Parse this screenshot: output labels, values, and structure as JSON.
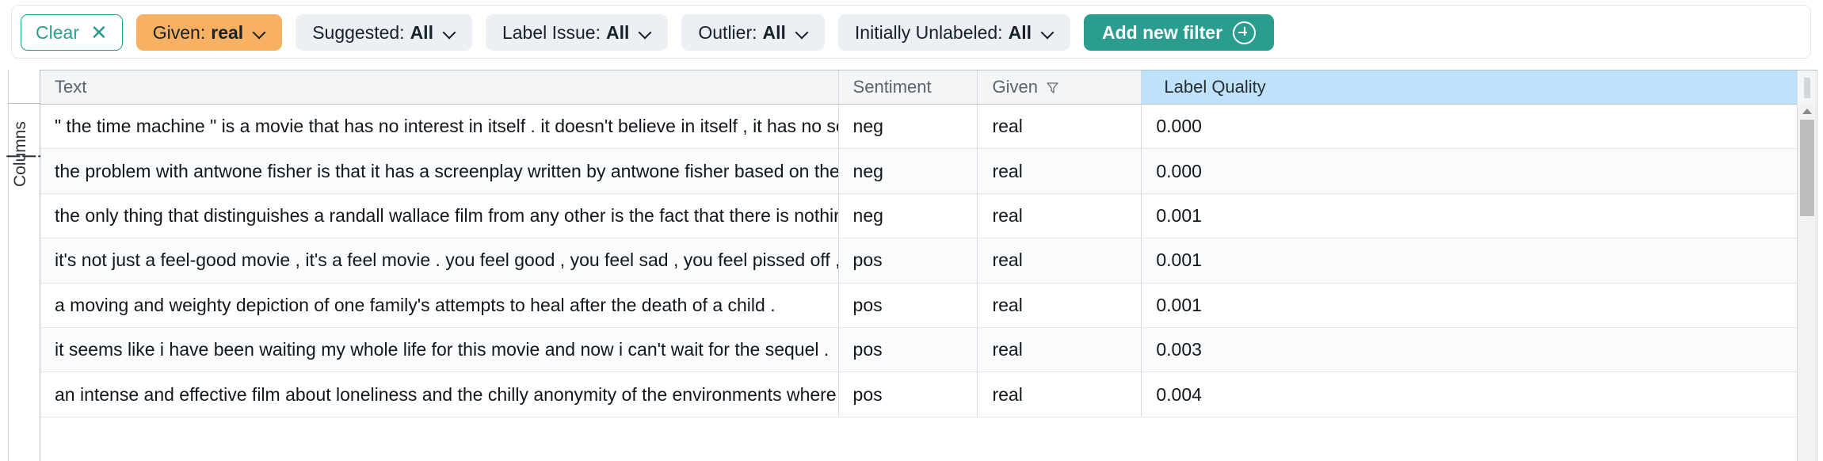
{
  "filter_bar": {
    "clear": {
      "label": "Clear",
      "icon": "close-icon",
      "glyph": "✕"
    },
    "filters": [
      {
        "label": "Given:",
        "value": "real",
        "active": true
      },
      {
        "label": "Suggested:",
        "value": "All",
        "active": false
      },
      {
        "label": "Label Issue:",
        "value": "All",
        "active": false
      },
      {
        "label": "Outlier:",
        "value": "All",
        "active": false
      },
      {
        "label": "Initially Unlabeled:",
        "value": "All",
        "active": false
      }
    ],
    "add_filter": {
      "label": "Add new filter",
      "icon": "plus-circle-icon"
    }
  },
  "columns_rail": {
    "label": "Columns",
    "icon": "columns-hamburger-icon"
  },
  "table": {
    "headers": [
      {
        "label": "Text",
        "selected": false,
        "filter_icon": false
      },
      {
        "label": "Sentiment",
        "selected": false,
        "filter_icon": false
      },
      {
        "label": "Given",
        "selected": false,
        "filter_icon": true
      },
      {
        "label": "Label Quality",
        "selected": true,
        "filter_icon": false
      }
    ],
    "rows": [
      {
        "text": "\" the time machine \" is a movie that has no interest in itself . it doesn't believe in itself , it has no sense of humor☐it's just p",
        "sentiment": "neg",
        "given": "real",
        "label_quality": "0.000"
      },
      {
        "text": "the problem with antwone fisher is that it has a screenplay written by antwone fisher based on the book by antwone fisher",
        "sentiment": "neg",
        "given": "real",
        "label_quality": "0.000"
      },
      {
        "text": "the only thing that distinguishes a randall wallace film from any other is the fact that there is nothing distinguishing in a ra",
        "sentiment": "neg",
        "given": "real",
        "label_quality": "0.001"
      },
      {
        "text": "it's not just a feel-good movie , it's a feel movie . you feel good , you feel sad , you feel pissed off , but in the end , you feel",
        "sentiment": "pos",
        "given": "real",
        "label_quality": "0.001"
      },
      {
        "text": "a moving and weighty depiction of one family's attempts to heal after the death of a child .",
        "sentiment": "pos",
        "given": "real",
        "label_quality": "0.001"
      },
      {
        "text": "it seems like i have been waiting my whole life for this movie and now i can't wait for the sequel .",
        "sentiment": "pos",
        "given": "real",
        "label_quality": "0.003"
      },
      {
        "text": "an intense and effective film about loneliness and the chilly anonymity of the environments where so many of us spend so",
        "sentiment": "pos",
        "given": "real",
        "label_quality": "0.004"
      }
    ]
  },
  "colors": {
    "accent_teal": "#2a9d8f",
    "active_chip_orange": "#f8b062",
    "selected_header_blue": "#bfe2fb",
    "chip_neutral": "#eceff3"
  }
}
